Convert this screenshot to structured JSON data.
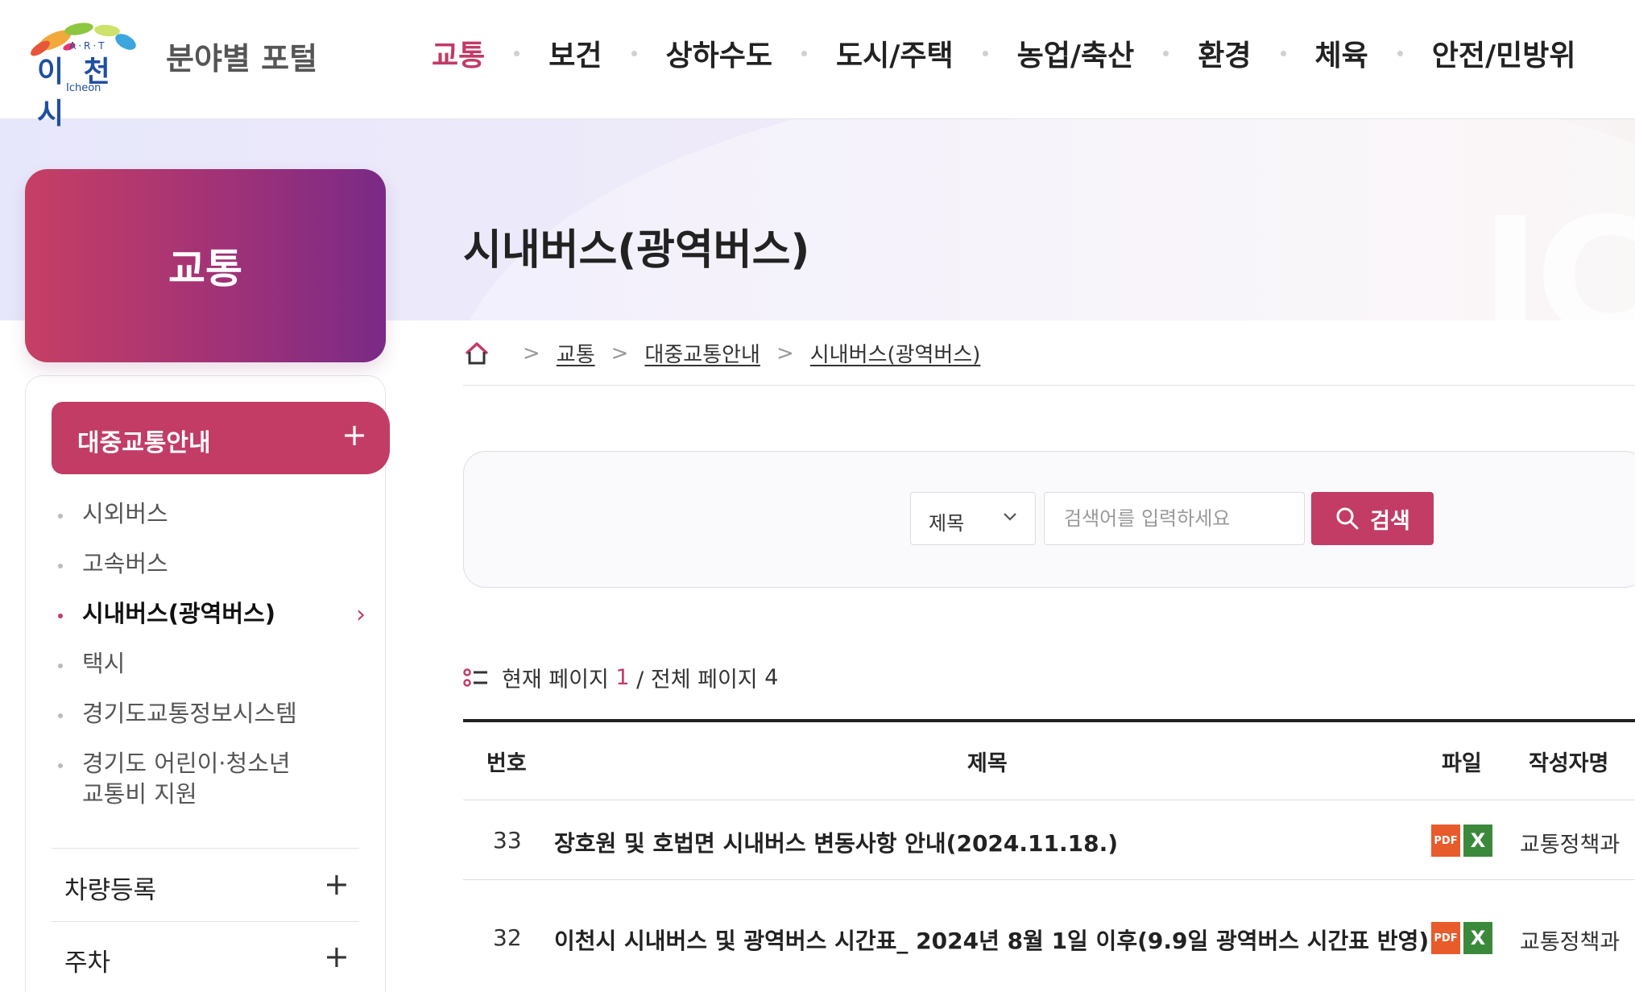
{
  "header": {
    "logo_art": "A·R·T",
    "logo_name": "이 천 시",
    "logo_sub": "Icheon",
    "portal_title": "분야별 포털",
    "nav": [
      {
        "label": "교통",
        "active": true
      },
      {
        "label": "보건"
      },
      {
        "label": "상하수도"
      },
      {
        "label": "도시/주택"
      },
      {
        "label": "농업/축산"
      },
      {
        "label": "환경"
      },
      {
        "label": "체육"
      },
      {
        "label": "안전/민방위"
      }
    ]
  },
  "visual": {
    "watermark": "IC"
  },
  "sidebar": {
    "title": "교통",
    "active_group": "대중교통안내",
    "sub_items": [
      {
        "label": "시외버스"
      },
      {
        "label": "고속버스"
      },
      {
        "label": "시내버스(광역버스)",
        "current": true
      },
      {
        "label": "택시"
      },
      {
        "label": "경기도교통정보시스템"
      },
      {
        "label": "경기도 어린이·청소년 교통비 지원"
      }
    ],
    "groups": [
      {
        "label": "차량등록"
      },
      {
        "label": "주차"
      }
    ],
    "plus_symbol": "+",
    "chevron_symbol": "›"
  },
  "main": {
    "page_title": "시내버스(광역버스)",
    "breadcrumb": [
      "교통",
      "대중교통안내",
      "시내버스(광역버스)"
    ],
    "breadcrumb_sep": ">",
    "search": {
      "select_value": "제목",
      "placeholder": "검색어를 입력하세요",
      "button_label": "검색"
    },
    "page_info": {
      "prefix": "현재 페이지",
      "current": "1",
      "middle": "/ 전체 페이지",
      "total": "4"
    },
    "table": {
      "headers": {
        "num": "번호",
        "title": "제목",
        "file": "파일",
        "author": "작성자명"
      },
      "rows": [
        {
          "num": "33",
          "title": "장호원 및 호법면 시내버스 변동사항 안내(2024.11.18.)",
          "pdf": "PDF",
          "xls": "X",
          "author": "교통정책과"
        },
        {
          "num": "32",
          "title": "이천시 시내버스 및 광역버스 시간표_ 2024년 8월 1일 이후(9.9일 광역버스 시간표 반영)",
          "pdf": "PDF",
          "xls": "X",
          "author": "교통정책과"
        }
      ]
    }
  },
  "colors": {
    "accent": "#c23c66",
    "purple": "#7a2a86",
    "logo_blue": "#1f4fa0"
  }
}
